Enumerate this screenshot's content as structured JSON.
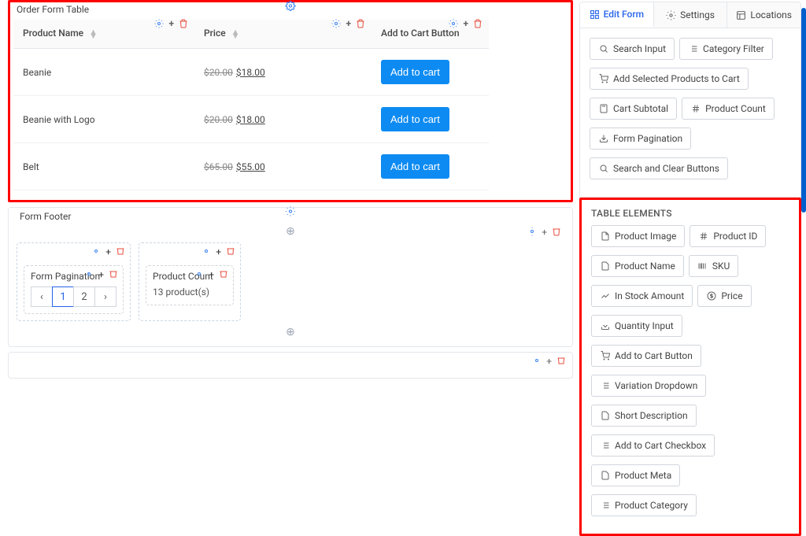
{
  "orderTable": {
    "title": "Order Form Table",
    "columns": [
      {
        "label": "Product Name"
      },
      {
        "label": "Price"
      },
      {
        "label": "Add to Cart Button"
      }
    ],
    "rows": [
      {
        "name": "Beanie",
        "old": "$20.00",
        "new": "$18.00",
        "btn": "Add to cart"
      },
      {
        "name": "Beanie with Logo",
        "old": "$20.00",
        "new": "$18.00",
        "btn": "Add to cart"
      },
      {
        "name": "Belt",
        "old": "$65.00",
        "new": "$55.00",
        "btn": "Add to cart"
      }
    ]
  },
  "footer": {
    "title": "Form Footer",
    "pagination": {
      "label": "Form Pagination",
      "pages": [
        "1",
        "2"
      ]
    },
    "productCount": {
      "label": "Product Count",
      "text": "13 product(s)"
    }
  },
  "sidebar": {
    "tabs": [
      {
        "label": "Edit Form"
      },
      {
        "label": "Settings"
      },
      {
        "label": "Locations"
      }
    ],
    "formElements": [
      "Search Input",
      "Category Filter",
      "Add Selected Products to Cart",
      "Cart Subtotal",
      "Product Count",
      "Form Pagination",
      "Search and Clear Buttons"
    ],
    "tableSection": "TABLE ELEMENTS",
    "tableElements": [
      "Product Image",
      "Product ID",
      "Product Name",
      "SKU",
      "In Stock Amount",
      "Price",
      "Quantity Input",
      "Add to Cart Button",
      "Variation Dropdown",
      "Short Description",
      "Add to Cart Checkbox",
      "Product Meta",
      "Product Category"
    ]
  }
}
